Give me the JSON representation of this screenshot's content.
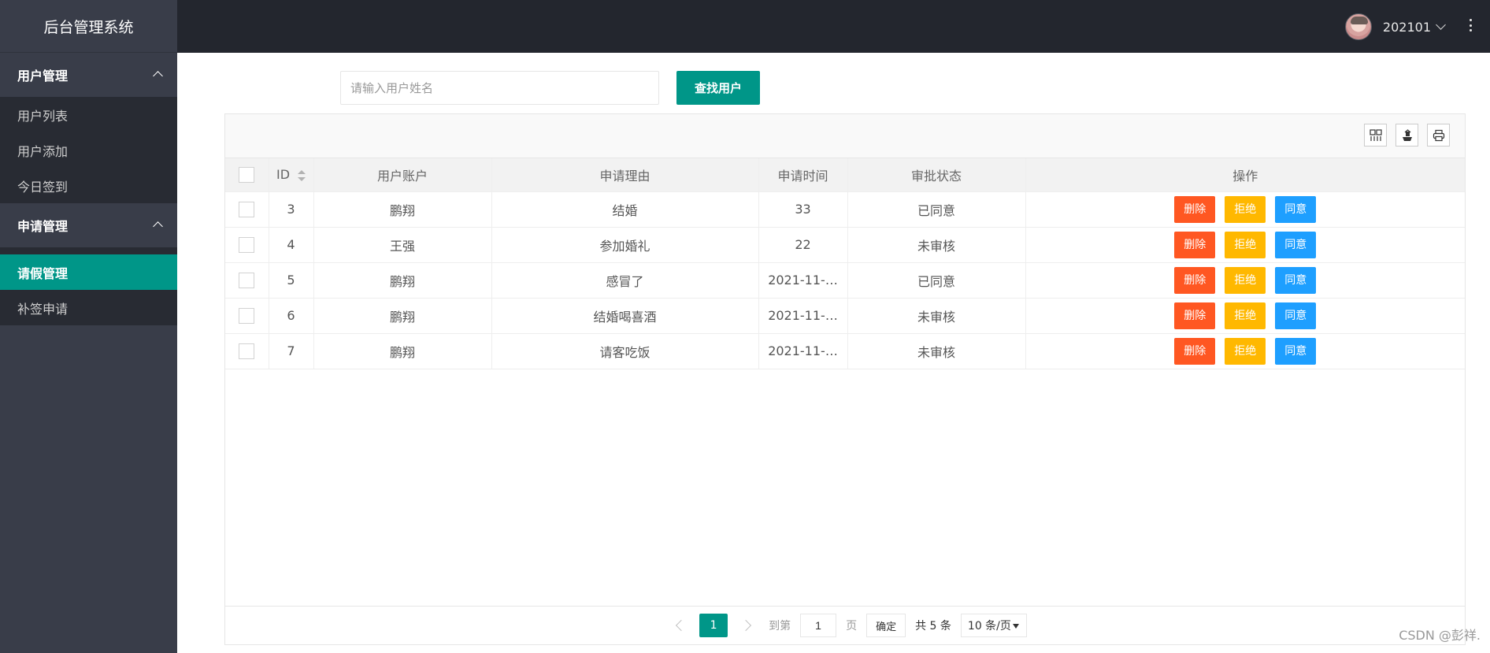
{
  "app": {
    "title": "后台管理系统"
  },
  "header": {
    "username": "202101"
  },
  "sidebar": {
    "groups": [
      {
        "title": "用户管理",
        "items": [
          "用户列表",
          "用户添加",
          "今日签到"
        ]
      },
      {
        "title": "申请管理",
        "items": [
          "请假管理",
          "补签申请"
        ],
        "active": "请假管理"
      }
    ]
  },
  "search": {
    "placeholder": "请输入用户姓名",
    "button_label": "查找用户"
  },
  "table": {
    "headers": [
      "ID",
      "用户账户",
      "申请理由",
      "申请时间",
      "审批状态",
      "操作"
    ],
    "rows": [
      {
        "id": "3",
        "account": "鹏翔",
        "reason": "结婚",
        "time": "33",
        "status": "已同意"
      },
      {
        "id": "4",
        "account": "王强",
        "reason": "参加婚礼",
        "time": "22",
        "status": "未审核"
      },
      {
        "id": "5",
        "account": "鹏翔",
        "reason": "感冒了",
        "time": "2021-11-…",
        "status": "已同意"
      },
      {
        "id": "6",
        "account": "鹏翔",
        "reason": "结婚喝喜酒",
        "time": "2021-11-…",
        "status": "未审核"
      },
      {
        "id": "7",
        "account": "鹏翔",
        "reason": "请客吃饭",
        "time": "2021-11-…",
        "status": "未审核"
      }
    ],
    "actions": {
      "delete": "删除",
      "refuse": "拒绝",
      "agree": "同意"
    }
  },
  "pager": {
    "current_page": "1",
    "goto_label": "到第",
    "goto_value": "1",
    "page_label": "页",
    "confirm_label": "确定",
    "total_label": "共 5 条",
    "limit_label": "10 条/页"
  },
  "watermark": "CSDN @彭祥."
}
